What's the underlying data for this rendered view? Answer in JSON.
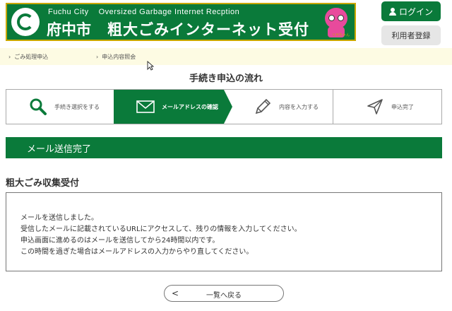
{
  "header": {
    "title_en_1": "Fuchu City",
    "title_en_2": "Oversized Garbage Internet Recption",
    "city_name": "府中市",
    "title_jp": "粗大ごみインターネット受付",
    "mascot_name": "リサちゃん",
    "logo_icon": "city-emblem-icon",
    "login_label": "ログイン",
    "register_label": "利用者登録",
    "brand_color": "#0a7a3a",
    "border_color": "#c9a800"
  },
  "subnav": {
    "items": [
      {
        "label": "ごみ処理申込"
      },
      {
        "label": "申込内容照会"
      }
    ],
    "chevron": "›"
  },
  "flow": {
    "title": "手続き申込の流れ",
    "steps": [
      {
        "label": "手続き選択をする",
        "icon": "search-icon",
        "active": false
      },
      {
        "label": "メールアドレスの確認",
        "icon": "mail-icon",
        "active": true
      },
      {
        "label": "内容を入力する",
        "icon": "pencil-icon",
        "active": false
      },
      {
        "label": "申込完了",
        "icon": "send-icon",
        "active": false
      }
    ]
  },
  "section": {
    "title": "メール送信完了"
  },
  "sub_heading": "粗大ごみ収集受付",
  "message": {
    "lines": [
      "メールを送信しました。",
      "受信したメールに記載されているURLにアクセスして、残りの情報を入力してください。",
      "申込画面に進めるのはメールを送信してから24時間以内です。",
      "この時間を過ぎた場合はメールアドレスの入力からやり直してください。"
    ]
  },
  "back_button": {
    "chevron": "<",
    "label": "一覧へ戻る"
  }
}
